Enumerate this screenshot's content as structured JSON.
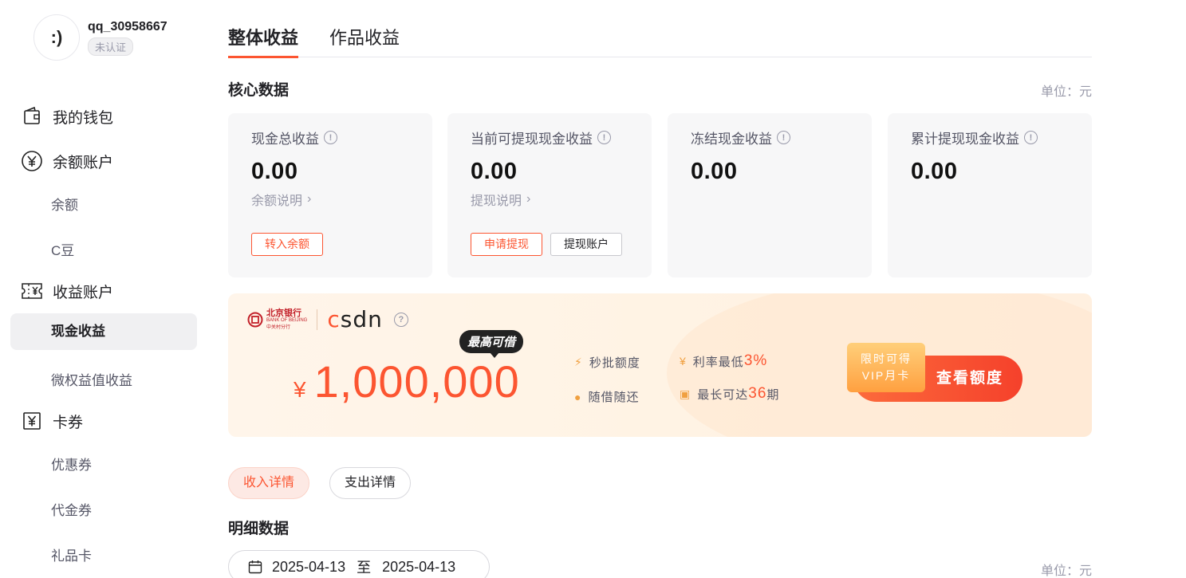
{
  "user": {
    "avatar_text": ":)",
    "name": "qq_30958667",
    "status": "未认证"
  },
  "sidebar": {
    "wallet": {
      "label": "我的钱包",
      "icon": "wallet-icon"
    },
    "balance_account": {
      "label": "余额账户",
      "icon": "yen-circle-icon"
    },
    "balance_items": [
      "余额",
      "C豆"
    ],
    "income_account": {
      "label": "收益账户",
      "icon": "ticket-yen-icon"
    },
    "income_items": [
      "现金收益",
      "微权益值收益"
    ],
    "coupons": {
      "label": "卡券",
      "icon": "coupon-yen-icon"
    },
    "coupon_items": [
      "优惠券",
      "代金券",
      "礼品卡"
    ]
  },
  "tabs": [
    "整体收益",
    "作品收益"
  ],
  "core": {
    "title": "核心数据",
    "unit": "单位：元",
    "cards": [
      {
        "label": "现金总收益",
        "value": "0.00",
        "link": "余额说明",
        "buttons": [
          "转入余额"
        ]
      },
      {
        "label": "当前可提现现金收益",
        "value": "0.00",
        "link": "提现说明",
        "buttons": [
          "申请提现",
          "提现账户"
        ]
      },
      {
        "label": "冻结现金收益",
        "value": "0.00"
      },
      {
        "label": "累计提现现金收益",
        "value": "0.00"
      }
    ]
  },
  "banner": {
    "bank_name": "北京银行",
    "bank_en": "BANK OF BEIJING",
    "bank_branch": "中关村分行",
    "brand": "CSDN",
    "max_tag": "最高可借",
    "currency": "¥",
    "amount": "1,000,000",
    "feat1": "秒批额度",
    "feat2": "随借随还",
    "feat3_pre": "利率最低",
    "feat3_hl": "3%",
    "feat4_pre": "最长可达",
    "feat4_hl": "36",
    "feat4_post": "期",
    "vip_line1": "限时可得",
    "vip_line2": "VIP月卡",
    "cta": "查看额度"
  },
  "detail": {
    "pill_income": "收入详情",
    "pill_expense": "支出详情",
    "title": "明细数据",
    "date_start": "2025-04-13",
    "date_sep": "至",
    "date_end": "2025-04-13",
    "unit": "单位：元"
  },
  "colors": {
    "accent": "#fc5531",
    "card_bg": "#f7f7f8"
  }
}
